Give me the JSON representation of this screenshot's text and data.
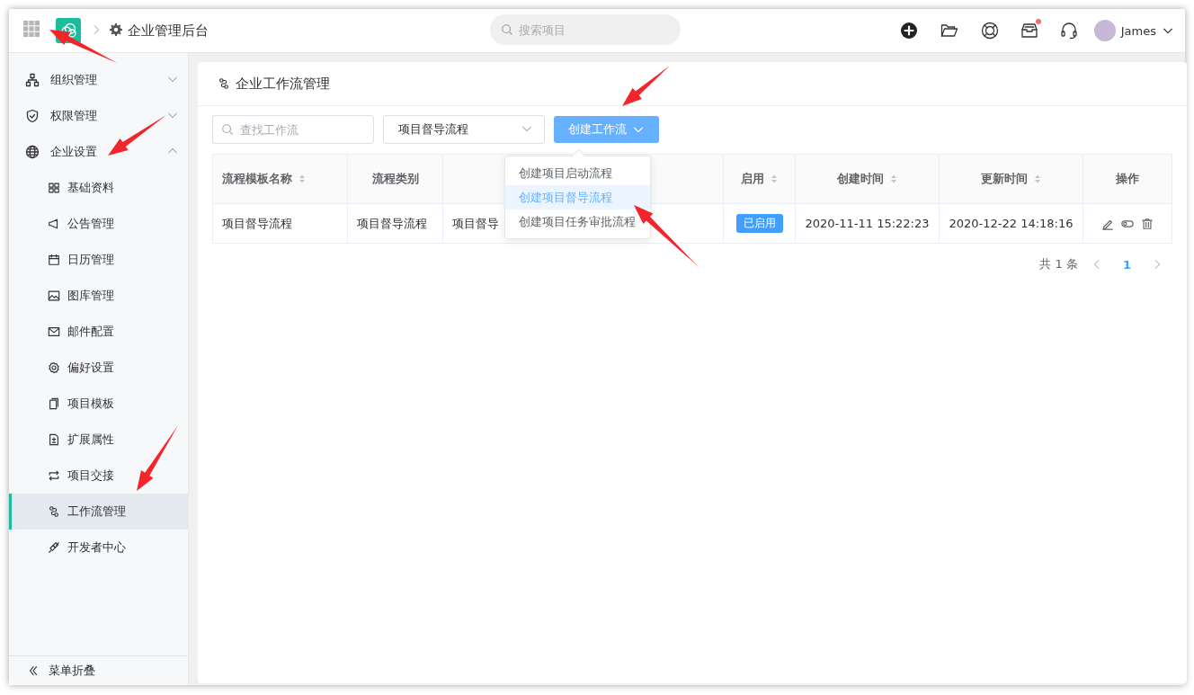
{
  "topbar": {
    "title": "企业管理后台",
    "search": {
      "placeholder": "搜索项目"
    },
    "inbox_unread": true,
    "user": {
      "name": "James"
    }
  },
  "sidebar": {
    "items": [
      {
        "label": "组织管理",
        "expanded": false
      },
      {
        "label": "权限管理",
        "expanded": false
      },
      {
        "label": "企业设置",
        "expanded": true,
        "children": [
          {
            "label": "基础资料",
            "selected": false
          },
          {
            "label": "公告管理",
            "selected": false
          },
          {
            "label": "日历管理",
            "selected": false
          },
          {
            "label": "图库管理",
            "selected": false
          },
          {
            "label": "邮件配置",
            "selected": false
          },
          {
            "label": "偏好设置",
            "selected": false
          },
          {
            "label": "项目模板",
            "selected": false
          },
          {
            "label": "扩展属性",
            "selected": false
          },
          {
            "label": "项目交接",
            "selected": false
          },
          {
            "label": "工作流管理",
            "selected": true
          },
          {
            "label": "开发者中心",
            "selected": false
          }
        ]
      }
    ],
    "collapse_label": "菜单折叠"
  },
  "page": {
    "title": "企业工作流管理",
    "search": {
      "placeholder": "查找工作流"
    },
    "filter": {
      "value": "项目督导流程"
    },
    "create_button": {
      "label": "创建工作流"
    },
    "create_menu": {
      "items": [
        {
          "label": "创建项目启动流程",
          "selected": false
        },
        {
          "label": "创建项目督导流程",
          "selected": true
        },
        {
          "label": "创建项目任务审批流程",
          "selected": false
        }
      ]
    },
    "table": {
      "columns": [
        {
          "label": "流程模板名称",
          "sortable": true
        },
        {
          "label": "流程类别",
          "sortable": false
        },
        {},
        {
          "label": "启用",
          "sortable": true
        },
        {
          "label": "创建时间",
          "sortable": true
        },
        {
          "label": "更新时间",
          "sortable": true
        },
        {
          "label": "操作",
          "sortable": false
        }
      ],
      "rows": [
        {
          "cells": [
            "项目督导流程",
            "项目督导流程",
            "项目督导"
          ],
          "status": {
            "label": "已启用",
            "on": true
          },
          "created_at": "2020-11-11 15:22:23",
          "updated_at": "2020-12-22 14:18:16"
        }
      ]
    },
    "pagination": {
      "total": "共 1 条",
      "pages": [
        {
          "label": "1",
          "selected": true
        }
      ]
    }
  }
}
